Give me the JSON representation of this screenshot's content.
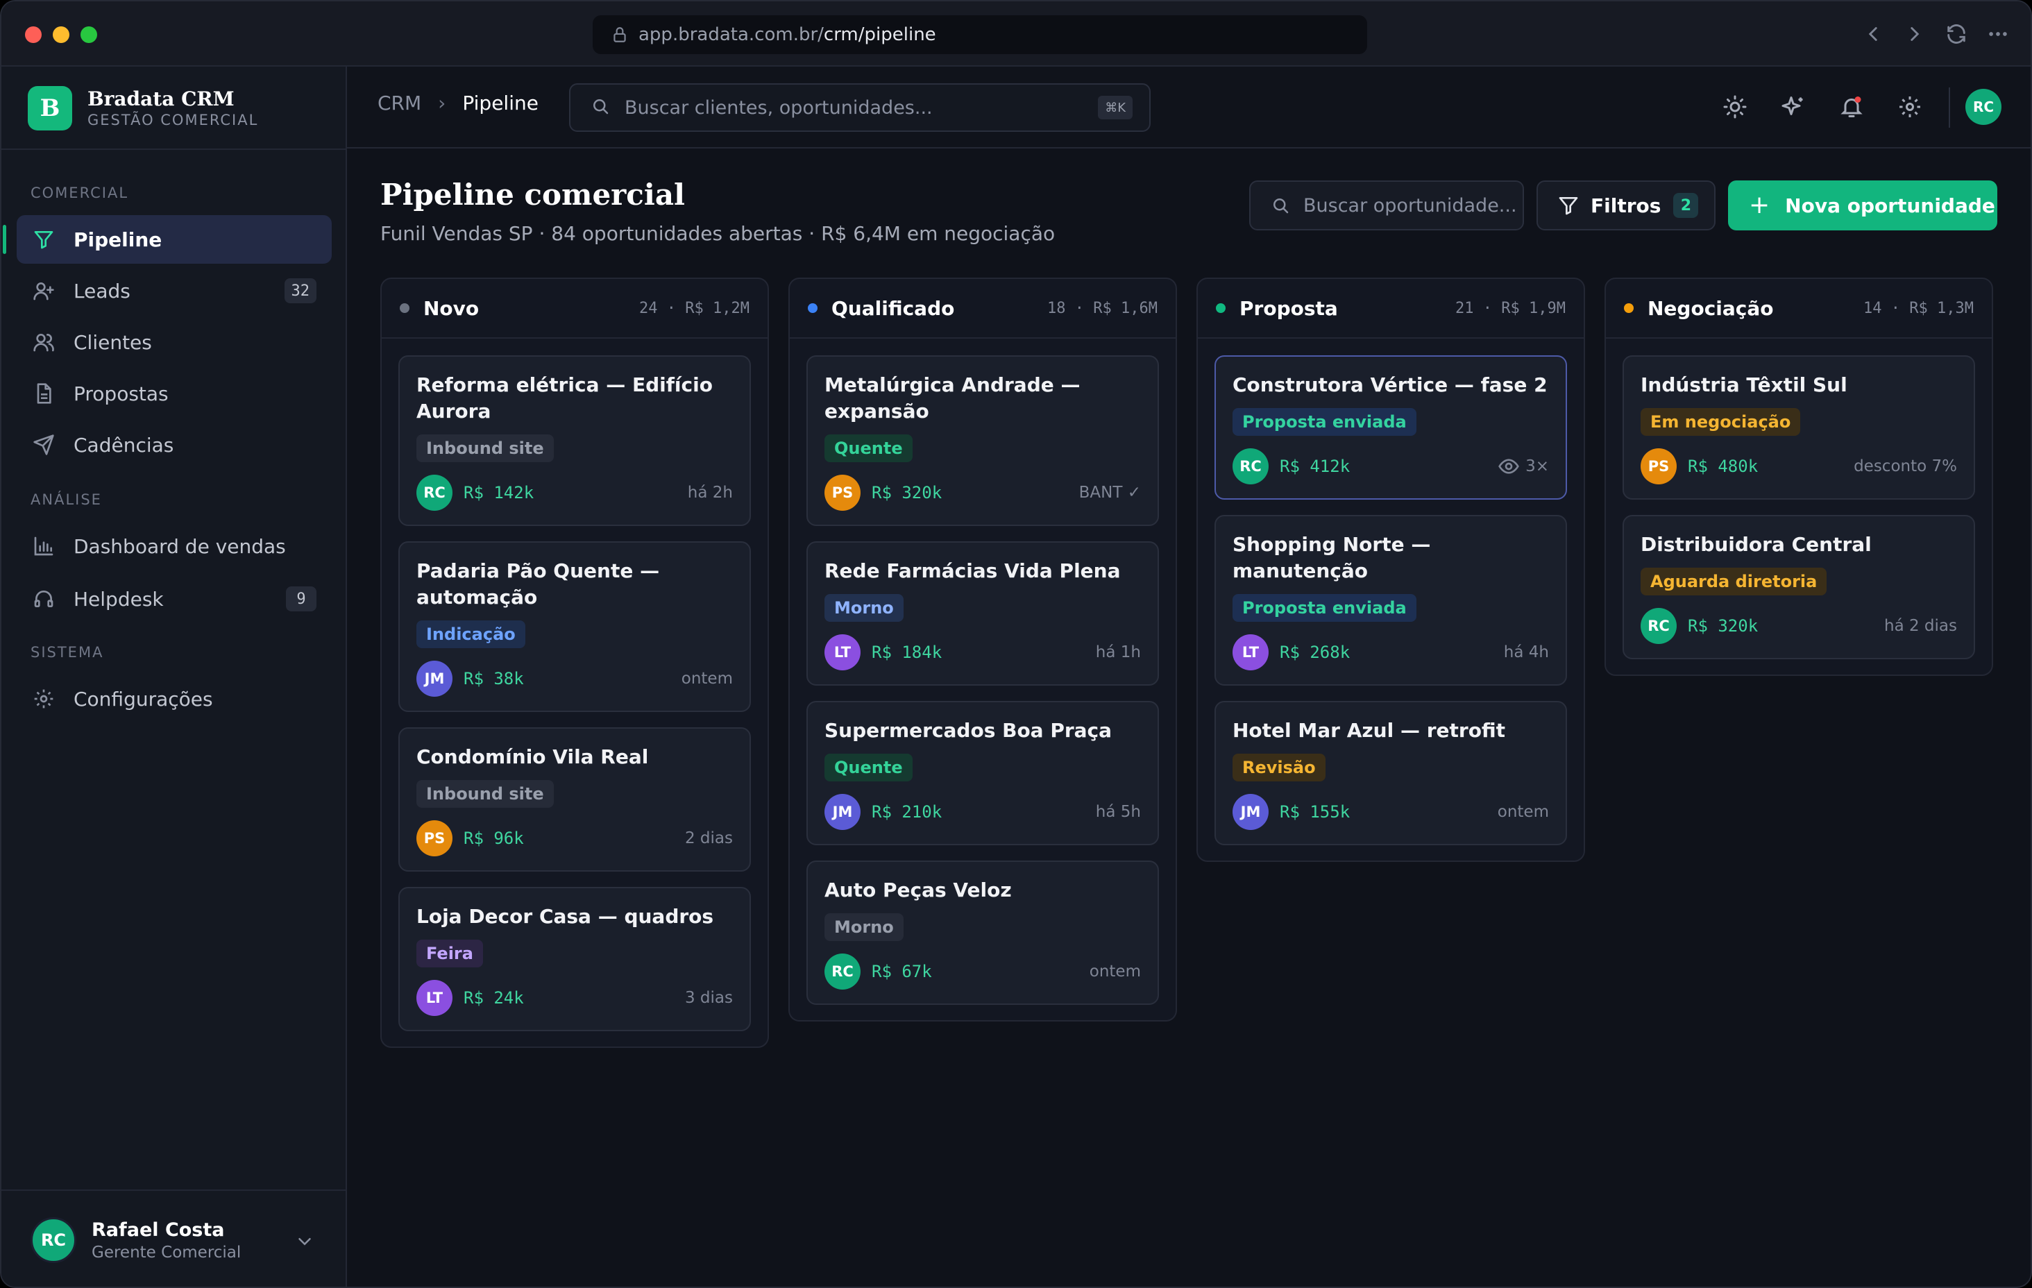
{
  "browser": {
    "url_host": "app.bradata.com.br/",
    "url_path": "crm/pipeline"
  },
  "brand": {
    "logo_letter": "B",
    "name": "Bradata CRM",
    "subtitle": "GESTÃO COMERCIAL"
  },
  "sidebar": {
    "sections": [
      "COMERCIAL",
      "ANÁLISE",
      "SISTEMA"
    ],
    "items": [
      {
        "label": "Pipeline",
        "icon": "filter-icon"
      },
      {
        "label": "Leads",
        "icon": "user-plus-icon",
        "count": "32"
      },
      {
        "label": "Clientes",
        "icon": "users-icon"
      },
      {
        "label": "Propostas",
        "icon": "document-icon"
      },
      {
        "label": "Cadências",
        "icon": "send-icon"
      },
      {
        "label": "Dashboard de vendas",
        "icon": "bar-chart-icon"
      },
      {
        "label": "Helpdesk",
        "icon": "headset-icon",
        "count": "9"
      },
      {
        "label": "Configurações",
        "icon": "gear-icon"
      }
    ]
  },
  "user": {
    "initials": "RC",
    "name": "Rafael Costa",
    "role": "Gerente Comercial"
  },
  "topbar": {
    "breadcrumb": [
      "CRM",
      "Pipeline"
    ],
    "search_placeholder": "Buscar clientes, oportunidades...",
    "search_shortcut": "⌘K",
    "avatar_initials": "RC"
  },
  "page": {
    "title": "Pipeline comercial",
    "subtitle": "Funil Vendas SP · 84 oportunidades abertas · R$ 6,4M em negociação",
    "search_placeholder": "Buscar oportunidade...",
    "filters_label": "Filtros",
    "filters_count": "2",
    "new_button_label": "Nova oportunidade"
  },
  "colors": {
    "accent": "#12b57e",
    "novo": "#6b7280",
    "qualificado": "#3b82f6",
    "proposta": "#10b981",
    "negociacao": "#f59e0b"
  },
  "columns": [
    {
      "name": "Novo",
      "stats": "24 · R$ 1,2M",
      "color": "#6b7280",
      "cards": [
        {
          "title": "Reforma elétrica — Edifício Aurora",
          "tag": "Inbound site",
          "tag_style": "gray",
          "avatar": "RC",
          "avatar_color": "#10a878",
          "amount": "R$ 142k",
          "meta": "há 2h"
        },
        {
          "title": "Padaria Pão Quente — automação",
          "tag": "Indicação",
          "tag_style": "blue",
          "avatar": "JM",
          "avatar_color": "#5b5bd6",
          "amount": "R$ 38k",
          "meta": "ontem"
        },
        {
          "title": "Condomínio Vila Real",
          "tag": "Inbound site",
          "tag_style": "gray",
          "avatar": "PS",
          "avatar_color": "#e58a0c",
          "amount": "R$ 96k",
          "meta": "2 dias"
        },
        {
          "title": "Loja Decor Casa — quadros",
          "tag": "Feira",
          "tag_style": "purple",
          "avatar": "LT",
          "avatar_color": "#8b4fe0",
          "amount": "R$ 24k",
          "meta": "3 dias"
        }
      ]
    },
    {
      "name": "Qualificado",
      "stats": "18 · R$ 1,6M",
      "color": "#3b82f6",
      "cards": [
        {
          "title": "Metalúrgica Andrade — expansão",
          "tag": "Quente",
          "tag_style": "green",
          "avatar": "PS",
          "avatar_color": "#e58a0c",
          "amount": "R$ 320k",
          "meta": "BANT ✓"
        },
        {
          "title": "Rede Farmácias Vida Plena",
          "tag": "Morno",
          "tag_style": "navy",
          "avatar": "LT",
          "avatar_color": "#8b4fe0",
          "amount": "R$ 184k",
          "meta": "há 1h"
        },
        {
          "title": "Supermercados Boa Praça",
          "tag": "Quente",
          "tag_style": "green",
          "avatar": "JM",
          "avatar_color": "#5b5bd6",
          "amount": "R$ 210k",
          "meta": "há 5h"
        },
        {
          "title": "Auto Peças Veloz",
          "tag": "Morno",
          "tag_style": "gray",
          "avatar": "RC",
          "avatar_color": "#10a878",
          "amount": "R$ 67k",
          "meta": "ontem"
        }
      ]
    },
    {
      "name": "Proposta",
      "stats": "21 · R$ 1,9M",
      "color": "#10b981",
      "cards": [
        {
          "title": "Construtora Vértice — fase 2",
          "tag": "Proposta enviada",
          "tag_style": "teal",
          "avatar": "RC",
          "avatar_color": "#10a878",
          "amount": "R$ 412k",
          "meta": "3×",
          "meta_icon": "eye-icon",
          "selected": true
        },
        {
          "title": "Shopping Norte — manutenção",
          "tag": "Proposta enviada",
          "tag_style": "teal",
          "avatar": "LT",
          "avatar_color": "#8b4fe0",
          "amount": "R$ 268k",
          "meta": "há 4h"
        },
        {
          "title": "Hotel Mar Azul — retrofit",
          "tag": "Revisão",
          "tag_style": "amber",
          "avatar": "JM",
          "avatar_color": "#5b5bd6",
          "amount": "R$ 155k",
          "meta": "ontem"
        }
      ]
    },
    {
      "name": "Negociação",
      "stats": "14 · R$ 1,3M",
      "color": "#f59e0b",
      "cards": [
        {
          "title": "Indústria Têxtil Sul",
          "tag": "Em negociação",
          "tag_style": "amber",
          "avatar": "PS",
          "avatar_color": "#e58a0c",
          "amount": "R$ 480k",
          "meta": "desconto 7%"
        },
        {
          "title": "Distribuidora Central",
          "tag": "Aguarda diretoria",
          "tag_style": "amber",
          "avatar": "RC",
          "avatar_color": "#10a878",
          "amount": "R$ 320k",
          "meta": "há 2 dias"
        }
      ]
    }
  ]
}
